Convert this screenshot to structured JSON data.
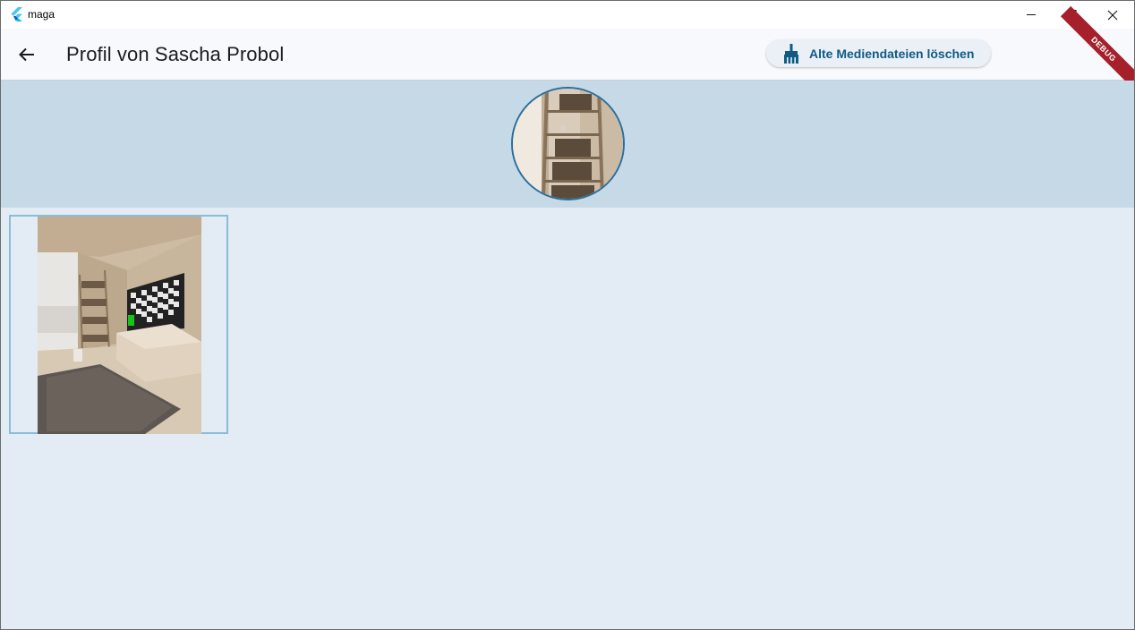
{
  "window": {
    "app_title": "maga",
    "controls": {
      "minimize_icon": "minimize-icon",
      "maximize_icon": "maximize-icon",
      "close_icon": "close-icon"
    }
  },
  "appbar": {
    "back_icon": "arrow-left-icon",
    "title": "Profil von Sascha Probol",
    "clean_button": {
      "label": "Alte Mediendateien löschen",
      "icon": "broom-icon"
    },
    "debug_banner": "DEBUG"
  },
  "colors": {
    "accent": "#0f5a86",
    "header_band": "#c6d9e7",
    "background": "#e3ebf4",
    "debug": "#a5202a"
  },
  "media": {
    "items": [
      {
        "kind": "image",
        "description": ""
      }
    ]
  }
}
